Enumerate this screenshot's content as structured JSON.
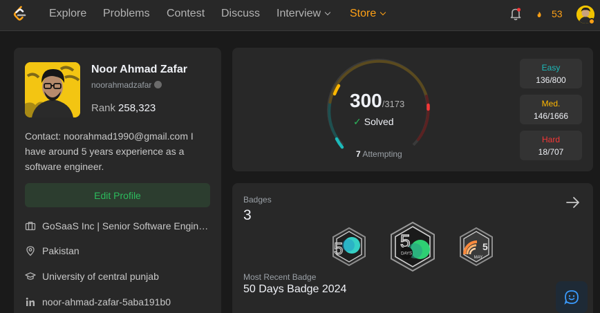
{
  "nav": {
    "items": [
      {
        "label": "Explore"
      },
      {
        "label": "Problems"
      },
      {
        "label": "Contest"
      },
      {
        "label": "Discuss"
      },
      {
        "label": "Interview"
      },
      {
        "label": "Store"
      }
    ],
    "streak_count": "53",
    "icons": {
      "logo": "leetcode-logo",
      "bell": "notification-bell-icon",
      "streak": "fire-icon"
    },
    "accent_color": "#ffa116"
  },
  "profile": {
    "name": "Noor Ahmad Zafar",
    "username": "noorahmadzafar",
    "rank_label": "Rank",
    "rank_value": "258,323",
    "about": "Contact: noorahmad1990@gmail.com I have around 5 years experience as a software engineer.",
    "edit_button": "Edit Profile",
    "info": {
      "company": "GoSaaS Inc | Senior Software Engineer",
      "location": "Pakistan",
      "school": "University of central punjab",
      "linkedin": "noor-ahmad-zafar-5aba191b0"
    }
  },
  "solved": {
    "count": "300",
    "total": "/3173",
    "label": "Solved",
    "attempting_count": "7",
    "attempting_label": "Attempting",
    "easy": {
      "label": "Easy",
      "value": "136/800",
      "color": "#1cbaba"
    },
    "medium": {
      "label": "Med.",
      "value": "146/1666",
      "color": "#ffb700"
    },
    "hard": {
      "label": "Hard",
      "value": "18/707",
      "color": "#f63737"
    }
  },
  "badges": {
    "title": "Badges",
    "count": "3",
    "items": [
      {
        "name": "50-days-badge-2024-small-icon"
      },
      {
        "name": "50-days-badge-2024-icon",
        "label": "DAYS"
      },
      {
        "name": "may-daily-badge-icon",
        "label": "MAY"
      }
    ],
    "recent_label": "Most Recent Badge",
    "recent_name": "50 Days Badge 2024"
  }
}
